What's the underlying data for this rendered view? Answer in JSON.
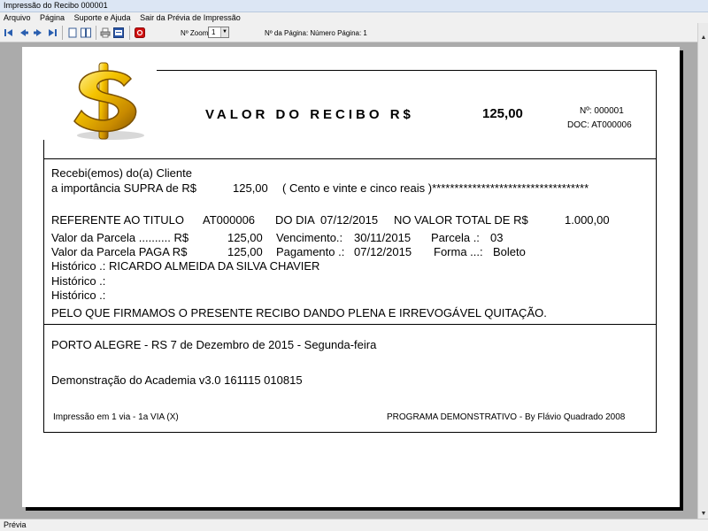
{
  "window": {
    "title": "Impressão do Recibo 000001"
  },
  "menu": [
    "Arquivo",
    "Página",
    "Suporte e Ajuda",
    "Sair da Prévia de Impressão"
  ],
  "toolbar": {
    "zoom_label": "Nº Zoom",
    "zoom_value": "1",
    "page_label": "Nº da Página: Número Página: 1",
    "icons": [
      "first-page-icon",
      "prev-page-icon",
      "next-page-icon",
      "last-page-icon",
      "single-page-icon",
      "two-page-icon",
      "print-icon",
      "word-export-icon",
      "pdf-export-icon"
    ]
  },
  "receipt": {
    "title": "VALOR DO RECIBO R$",
    "title_value": "125,00",
    "numero": "Nº: 000001",
    "doc": "DOC: AT000006",
    "recebi": "Recebi(emos) do(a) Cliente",
    "importancia": "a importância SUPRA de R$",
    "importancia_valor": "125,00",
    "extenso": "( Cento e vinte e cinco reais )***********************************",
    "referente_label": "REFERENTE AO TITULO",
    "referente_titulo": "AT000006",
    "do_dia_label": "DO DIA",
    "do_dia": "07/12/2015",
    "valor_total_label": "NO VALOR TOTAL DE R$",
    "valor_total": "1.000,00",
    "parcela_label": "Valor da Parcela .......... R$",
    "parcela_valor": "125,00",
    "vencimento_label": "Vencimento.:",
    "vencimento": "30/11/2015",
    "parcela_num_label": "Parcela .:",
    "parcela_num": "03",
    "paga_label": "Valor da Parcela PAGA R$",
    "paga_valor": "125,00",
    "pagamento_label": "Pagamento .:",
    "pagamento": "07/12/2015",
    "forma_label": "Forma ...:",
    "forma": "Boleto",
    "historico1": "Histórico .: RICARDO ALMEIDA DA SILVA CHAVIER",
    "historico2": "Histórico .:",
    "historico3": "Histórico .:",
    "declaracao": "PELO QUE FIRMAMOS O PRESENTE RECIBO DANDO PLENA E IRREVOGÁVEL QUITAÇÃO.",
    "local_data": "PORTO ALEGRE - RS  7 de Dezembro de 2015 - Segunda-feira",
    "demonstracao": "Demonstração do Academia v3.0 161115 010815",
    "impressao": "Impressão em 1 via  -  1a VIA (X)",
    "programa": "PROGRAMA DEMONSTRATIVO - By Flávio Quadrado 2008"
  },
  "status": {
    "text": "Prévia"
  },
  "colors": {
    "chrome": "#f0f0f0",
    "workspace": "#ababab",
    "logo_gold": "#e8b400",
    "pdf_red": "#d01010"
  }
}
